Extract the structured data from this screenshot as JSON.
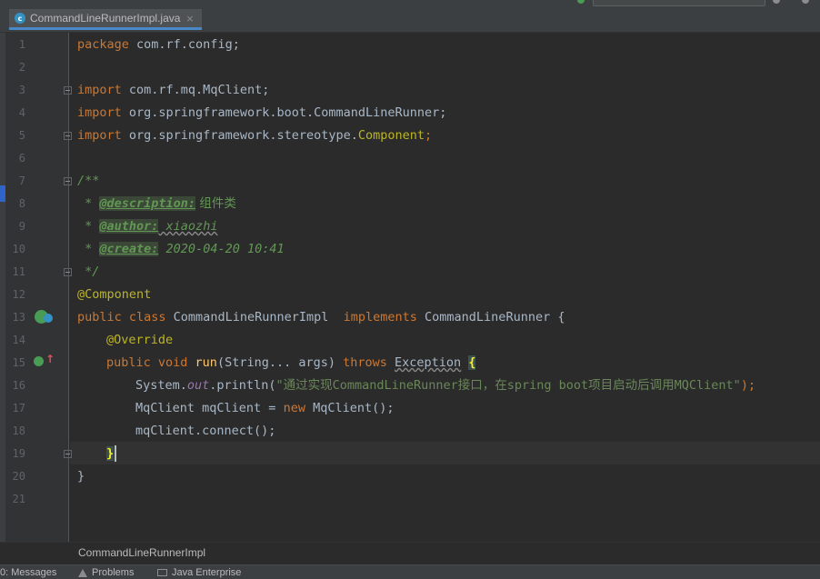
{
  "editor": {
    "tab": {
      "filename": "CommandLineRunnerImpl.java",
      "icon": "c",
      "close": "×"
    },
    "line_numbers": [
      "1",
      "2",
      "3",
      "4",
      "5",
      "6",
      "7",
      "8",
      "9",
      "10",
      "11",
      "12",
      "13",
      "14",
      "15",
      "16",
      "17",
      "18",
      "19",
      "20",
      "21"
    ],
    "code": {
      "l1": {
        "kw": "package",
        "text": " com.rf.config;"
      },
      "l3": {
        "kw": "import",
        "text": " com.rf.mq.MqClient;"
      },
      "l4": {
        "kw": "import",
        "text": " org.springframework.boot.CommandLineRunner;"
      },
      "l5": {
        "kw": "import",
        "text": " org.springframework.stereotype.",
        "cls": "Component",
        "end": ";"
      },
      "l7": {
        "doc": "/**"
      },
      "l8": {
        "star": " * ",
        "tag": "@description:",
        "val": " 组件类"
      },
      "l9": {
        "star": " * ",
        "tag": "@author:",
        "val": " xiaozhi"
      },
      "l10": {
        "star": " * ",
        "tag": "@create:",
        "val": " 2020-04-20 10:41"
      },
      "l11": {
        "doc": " */"
      },
      "l12": {
        "ann": "@Component"
      },
      "l13": {
        "kw1": "public class",
        "name": " CommandLineRunnerImpl  ",
        "kw2": "implements",
        "iface": " CommandLineRunner {"
      },
      "l14": {
        "ann": "@Override"
      },
      "l15": {
        "kw": "public void",
        "meth": "run",
        "args": "(String... args) ",
        "throws": "throws",
        "exc": "Exception",
        "brace": "{"
      },
      "l16": {
        "pre": "System.",
        "field": "out",
        "call": ".println(",
        "str": "\"通过实现CommandLineRunner接口，在spring boot项目启动后调用MQClient\"",
        "end": ");"
      },
      "l17": {
        "pre": "MqClient mqClient = ",
        "kw": "new",
        "post": " MqClient();"
      },
      "l18": {
        "text": "mqClient.connect();"
      },
      "l19": {
        "brace": "}"
      },
      "l20": {
        "text": "}"
      }
    },
    "breadcrumb": "CommandLineRunnerImpl"
  },
  "statusbar": {
    "messages": "0: Messages",
    "problems": "Problems",
    "java_enterprise": "Java Enterprise"
  },
  "colors": {
    "background": "#2b2b2b",
    "gutter": "#313335",
    "keyword": "#cc7832",
    "annotation": "#bbb529",
    "javadoc": "#629755",
    "string": "#6a8759",
    "method": "#ffc66d",
    "field": "#9876aa",
    "text": "#a9b7c6",
    "line_number": "#606366"
  }
}
